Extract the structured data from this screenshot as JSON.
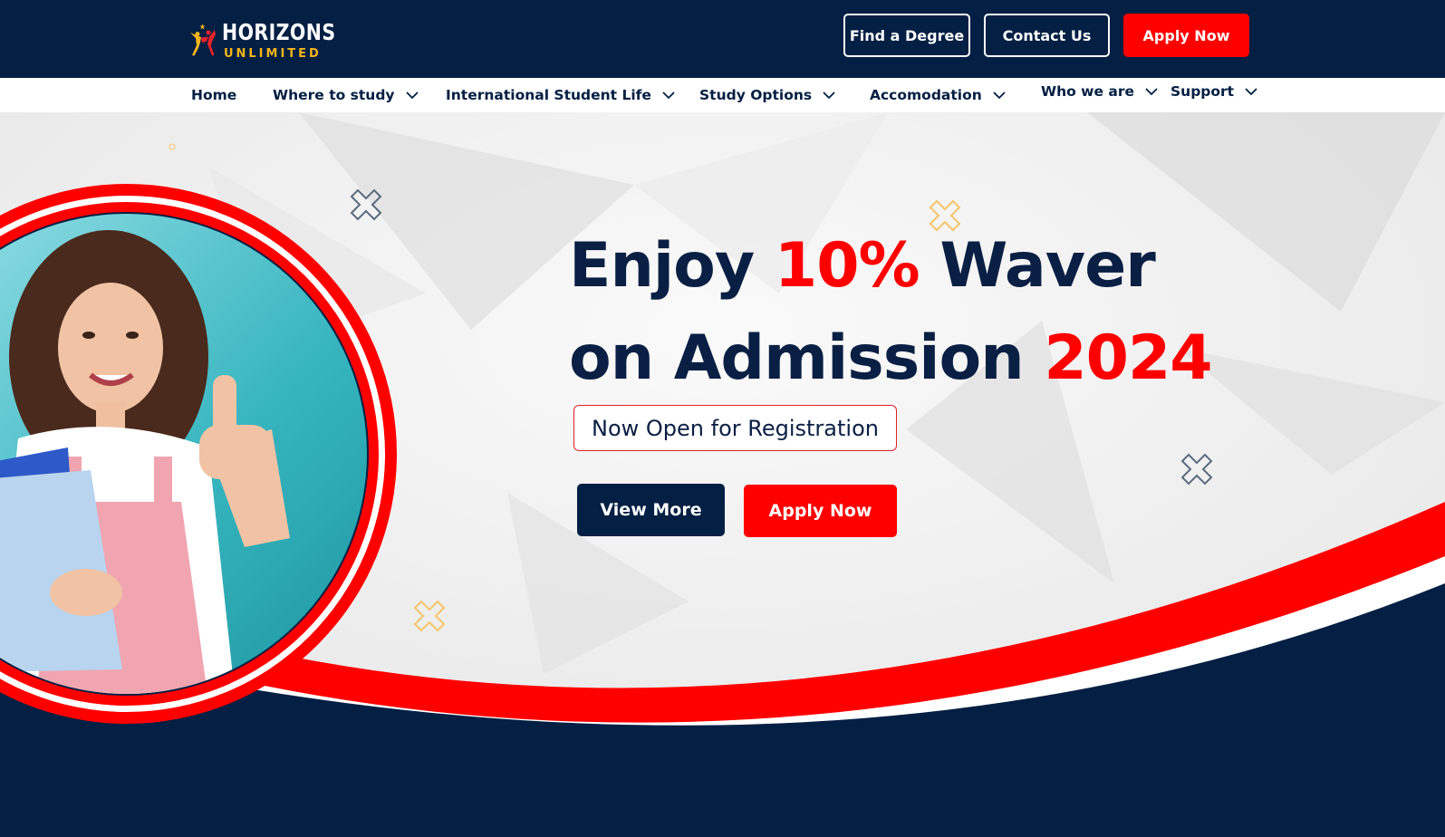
{
  "brand": {
    "name": "HORIZONS",
    "tagline": "UNLIMITED"
  },
  "header": {
    "find_degree": "Find a Degree",
    "contact_us": "Contact Us",
    "apply_now": "Apply Now"
  },
  "nav": {
    "items": [
      {
        "label": "Home"
      },
      {
        "label": "Where to study"
      },
      {
        "label": "International Student Life"
      },
      {
        "label": "Study Options"
      },
      {
        "label": "Accomodation"
      },
      {
        "label": "Who we are"
      },
      {
        "label": "Support"
      }
    ]
  },
  "hero": {
    "line1_a": "Enjoy ",
    "line1_highlight": "10%",
    "line1_b": " Waver",
    "line2_a": "on Admission ",
    "line2_highlight": "2024",
    "registration": "Now Open for Registration",
    "view_more": "View More",
    "apply_now": "Apply Now"
  },
  "colors": {
    "navy": "#031f43",
    "red": "#ff0000",
    "gold": "#f6b41a",
    "white": "#ffffff"
  },
  "icons": [
    "logo-mark-icon",
    "chevron-down-icon",
    "x-mark-icon"
  ]
}
